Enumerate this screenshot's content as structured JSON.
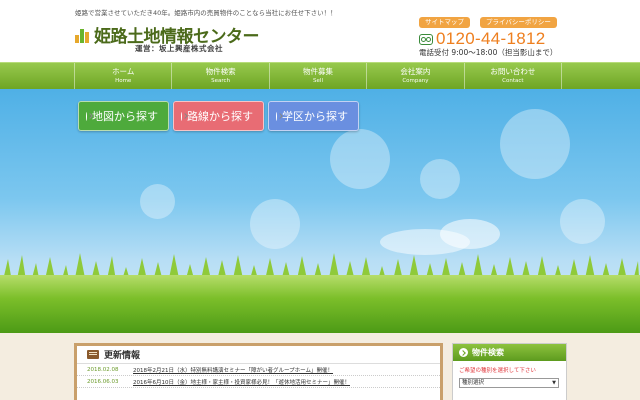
{
  "header": {
    "tagline": "姫路で営業させていただき40年。姫路市内の売買物件のことなら当社にお任せ下さい！！",
    "logo": "姫路土地情報センター",
    "operator": "運営：坂上興産株式会社",
    "sitemap_label": "サイトマップ",
    "privacy_label": "プライバシーポリシー",
    "phone": "0120-44-1812",
    "hours": "電話受付 9:00～18:00（担当影山まで）"
  },
  "nav": {
    "items": [
      {
        "jp": "ホーム",
        "en": "Home"
      },
      {
        "jp": "物件検索",
        "en": "Search"
      },
      {
        "jp": "物件募集",
        "en": "Sell"
      },
      {
        "jp": "会社案内",
        "en": "Company"
      },
      {
        "jp": "お問い合わせ",
        "en": "Contact"
      }
    ]
  },
  "hero": {
    "buttons": {
      "map": "地図から探す",
      "line": "路線から探す",
      "school": "学区から探す"
    }
  },
  "news": {
    "title": "更新情報",
    "items": [
      {
        "date": "2018.02.08",
        "text": "2018年2月21日（水）特別無料講演セミナー「障がい者グループホーム」開催！"
      },
      {
        "date": "2016.06.03",
        "text": "2016年6月10日（金）地主様・家主様・投資家様必見！「遊休地活用セミナー」開催！"
      }
    ]
  },
  "sidebar": {
    "title": "物件検索",
    "note": "ご希望の種別を選択して下さい",
    "select_value": "種別選択"
  },
  "colors": {
    "brand_green": "#6ea524",
    "phone_orange": "#ee7f1f",
    "map_button": "#4eaa3c",
    "line_button": "#e86c74",
    "school_button": "#6a8fe0"
  }
}
